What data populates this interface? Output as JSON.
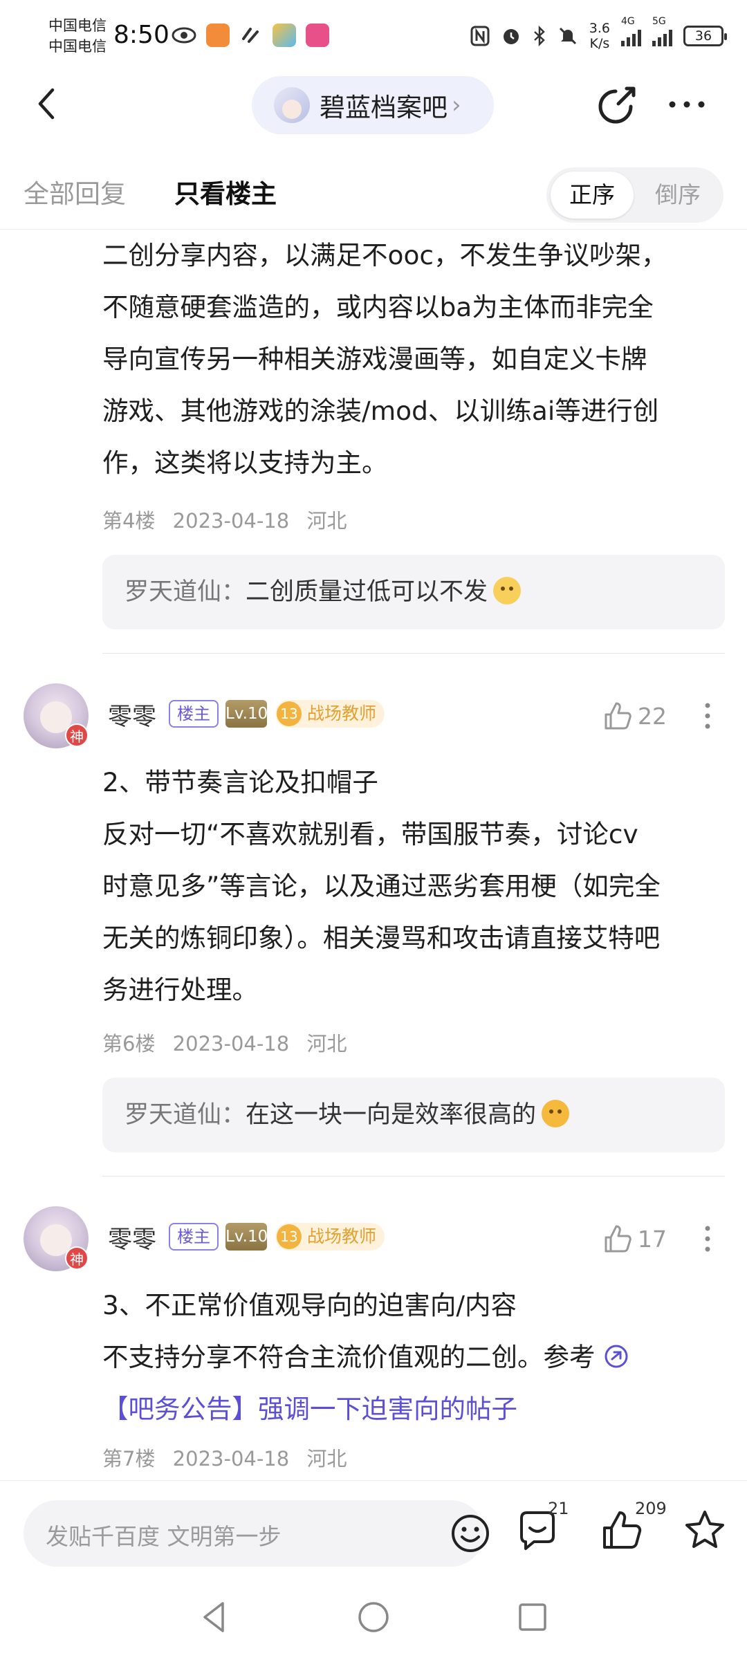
{
  "status_bar": {
    "carrier_1": "中国电信",
    "carrier_2": "中国电信",
    "time": "8:50",
    "net_speed_value": "3.6",
    "net_speed_unit": "K/s",
    "network_1": "4G",
    "network_2": "5G",
    "battery": "36"
  },
  "header": {
    "forum_name": "碧蓝档案吧",
    "forum_chevron": "›"
  },
  "tabs": {
    "all_replies": "全部回复",
    "only_op": "只看楼主",
    "sort_asc": "正序",
    "sort_desc": "倒序"
  },
  "floor_4": {
    "lines": [
      "二创分享内容，以满足不ooc，不发生争议吵架，",
      "不随意硬套滥造的，或内容以ba为主体而非完全",
      "导向宣传另一种相关游戏漫画等，如自定义卡牌",
      "游戏、其他游戏的涂装/mod、以训练ai等进行创",
      "作，这类将以支持为主。"
    ],
    "floor": "第4楼",
    "date": "2023-04-18",
    "location": "河北",
    "sub_reply_user": "罗天道仙：",
    "sub_reply_text": "二创质量过低可以不发"
  },
  "floor_6": {
    "username": "零零",
    "op_badge": "楼主",
    "level_badge": "Lv.10",
    "rank_num": "13",
    "rank_title": "战场教师",
    "god_badge": "神",
    "likes": "22",
    "lines": [
      "2、带节奏言论及扣帽子",
      "反对一切“不喜欢就别看，带国服节奏，讨论cv",
      "时意见多”等言论，以及通过恶劣套用梗（如完全",
      "无关的炼铜印象）。相关漫骂和攻击请直接艾特吧",
      "务进行处理。"
    ],
    "floor": "第6楼",
    "date": "2023-04-18",
    "location": "河北",
    "sub_reply_user": "罗天道仙：",
    "sub_reply_text": "在这一块一向是效率很高的"
  },
  "floor_7": {
    "username": "零零",
    "op_badge": "楼主",
    "level_badge": "Lv.10",
    "rank_num": "13",
    "rank_title": "战场教师",
    "god_badge": "神",
    "likes": "17",
    "line_1": "3、不正常价值观导向的迫害向/内容",
    "line_2": "不支持分享不符合主流价值观的二创。参考",
    "link_text": "【吧务公告】强调一下迫害向的帖子",
    "floor": "第7楼",
    "date": "2023-04-18",
    "location": "河北"
  },
  "bottom_bar": {
    "placeholder": "发贴千百度 文明第一步",
    "comment_count": "21",
    "like_count": "209"
  },
  "icons": {
    "back": "chevron-left-icon",
    "share": "share-icon",
    "more": "more-dots-icon",
    "like": "thumbs-up-icon",
    "emoji": "smiley-icon",
    "comment": "comment-icon",
    "star": "star-icon",
    "link": "link-icon"
  },
  "colors": {
    "accent_purple": "#5b4fd8",
    "rank_gold": "#e3a030",
    "god_red": "#e04848"
  }
}
